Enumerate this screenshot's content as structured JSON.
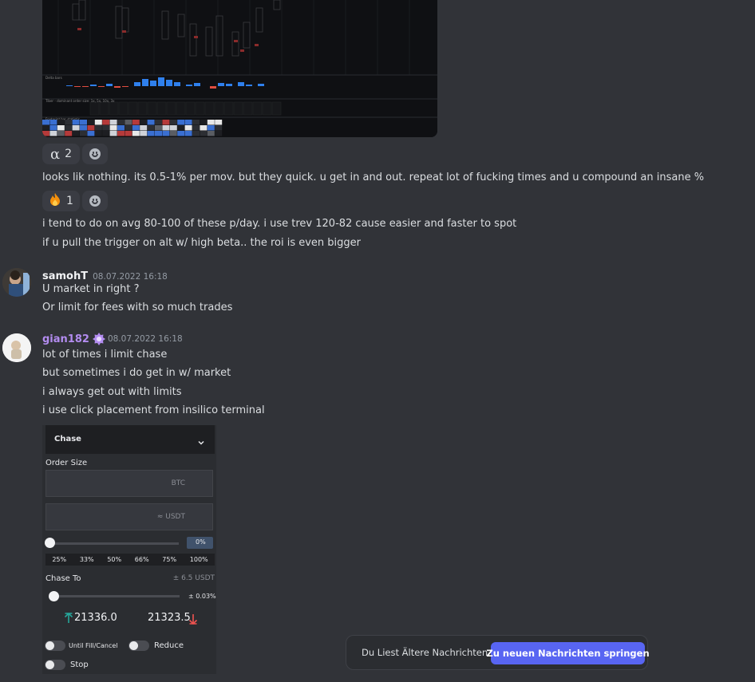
{
  "chart_image": {
    "indicator_labels": [
      "Delta bars",
      "Tiber - dominant order size: 1x, 5x, 10x, 3x",
      "Footprint bar statistic"
    ]
  },
  "reactions_1": {
    "emoji": "α",
    "count": "2"
  },
  "msg_a": "looks lik nothing. its 0.5-1% per mov. but they quick. u get in and out. repeat lot of fucking times and u compound an insane %",
  "reactions_2": {
    "emoji": "🔥",
    "count": "1"
  },
  "msg_b": "i tend to do on avg 80-100 of these p/day. i use trev 120-82 cause easier and faster to spot",
  "msg_c": "if u pull the trigger on alt w/ high beta.. the roi is even bigger",
  "samoh": {
    "username": "samohT",
    "timestamp": "08.07.2022 16:18",
    "lines": [
      "U market in right ?",
      "Or limit for fees with so much trades"
    ],
    "name_color": "#f2f3f5"
  },
  "gian": {
    "username": "gian182",
    "timestamp": "08.07.2022 16:18",
    "lines": [
      "lot of times i limit chase",
      "but sometimes i do get in w/ market",
      "i always get out with limits",
      "i use click placement from insilico terminal"
    ],
    "name_color": "#b38cf0"
  },
  "order_panel": {
    "dropdown": "Chase",
    "order_size_label": "Order Size",
    "btc_placeholder": "BTC",
    "usdt_placeholder": "≈ USDT",
    "slider_value": "0%",
    "percents": [
      "25%",
      "33%",
      "50%",
      "66%",
      "75%",
      "100%"
    ],
    "chase_to_label": "Chase To",
    "chase_to_value": "± 6.5 USDT",
    "chase_pct": "± 0.03%",
    "buy_price": "21336.0",
    "sell_price": "21323.5",
    "toggle_until_fill": "Until Fill/Cancel",
    "toggle_reduce": "Reduce",
    "toggle_stop": "Stop",
    "buy_color": "#26a69a",
    "sell_color": "#ef5350"
  },
  "jump_bar": {
    "info": "Du Liest Ältere Nachrichten",
    "button": "Zu neuen Nachrichten springen"
  }
}
